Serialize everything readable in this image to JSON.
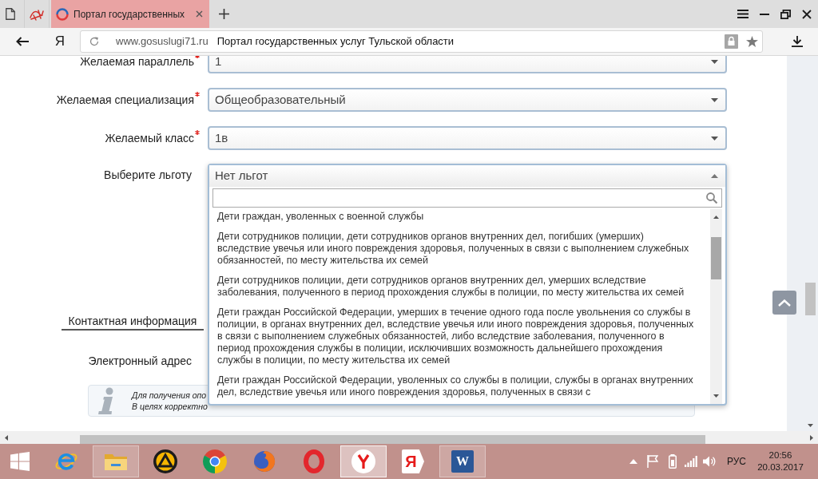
{
  "browser": {
    "tabs": [
      {
        "kind": "pinned",
        "selected": false
      },
      {
        "kind": "page",
        "title": "Портал государственных",
        "selected": true
      }
    ],
    "home_button": "Я",
    "address": {
      "url": "www.gosuslugi71.ru",
      "page_title": "Портал государственных услуг Тульской области"
    }
  },
  "form": {
    "fields": [
      {
        "label": "Желаемая параллель",
        "required": true,
        "value": "1",
        "expanded": false
      },
      {
        "label": "Желаемая специализация",
        "required": true,
        "value": "Общеобразовательный",
        "expanded": false
      },
      {
        "label": "Желаемый класс",
        "required": true,
        "value": "1в",
        "expanded": false
      },
      {
        "label": "Выберите льготу",
        "required": false,
        "value": "Нет льгот",
        "expanded": true
      }
    ]
  },
  "benefit_list": {
    "options": [
      {
        "text": "Дети граждан, уволенных с военной службы",
        "selected": false
      },
      {
        "text": "Дети сотрудников полиции, дети сотрудников органов внутренних дел, погибших (умерших) вследствие увечья или иного повреждения здоровья, полученных в связи с выполнением служебных обязанностей, по месту жительства их семей",
        "selected": false
      },
      {
        "text": "Дети сотрудников полиции, дети сотрудников органов внутренних дел, умерших вследствие заболевания, полученного в период прохождения службы в полиции, по месту жительства их семей",
        "selected": false
      },
      {
        "text": "Дети граждан Российской Федерации, умерших в течение одного года после увольнения со службы в полиции, в органах внутренних дел, вследствие увечья или иного повреждения здоровья, полученных в связи с выполнением служебных обязанностей, либо вследствие заболевания, полученного в период прохождения службы в полиции, исключивших возможность дальнейшего прохождения службы в полиции, по месту жительства их семей",
        "selected": false
      },
      {
        "text": "Дети граждан Российской Федерации, уволенных со службы в полиции, службы в органах внутренних дел, вследствие увечья или иного повреждения здоровья, полученных в связи с",
        "selected": false
      }
    ]
  },
  "contact": {
    "heading": "Контактная информация",
    "email_label": "Электронный адрес",
    "notice_lines": [
      "Для получения опо",
      "В целях корректно"
    ]
  },
  "taskbar": {
    "apps": [
      {
        "kind": "e-logo",
        "running": false,
        "selected": false
      },
      {
        "kind": "folder",
        "running": true,
        "selected": false
      },
      {
        "kind": "triangle-disc",
        "running": false,
        "selected": false
      },
      {
        "kind": "pinwheel",
        "running": false,
        "selected": false
      },
      {
        "kind": "swirl-globe",
        "running": false,
        "selected": false
      },
      {
        "kind": "ring",
        "running": false,
        "selected": false
      },
      {
        "kind": "y-disc",
        "running": true,
        "selected": true
      },
      {
        "kind": "letter-tag",
        "glyph": "Я",
        "running": false,
        "selected": false
      },
      {
        "kind": "letter-doc",
        "glyph": "W",
        "running": true,
        "selected": false
      }
    ],
    "tray": {
      "language": "РУС",
      "time": "20:56",
      "date": "20.03.2017"
    }
  }
}
